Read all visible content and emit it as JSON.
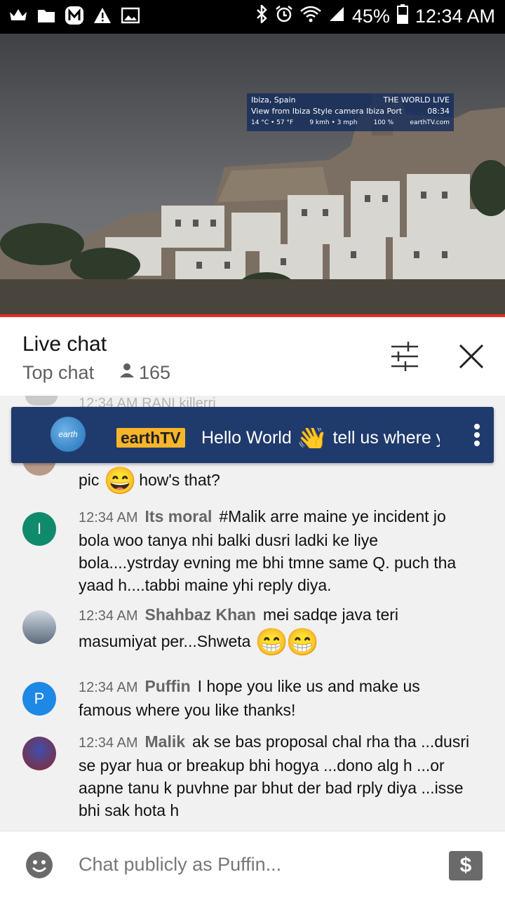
{
  "status_bar": {
    "battery": "45%",
    "time": "12:34 AM",
    "icons": [
      "crown-icon",
      "folder-icon",
      "m-app-icon",
      "warning-icon",
      "image-icon",
      "bluetooth-icon",
      "alarm-icon",
      "wifi-icon",
      "signal-icon",
      "battery-icon"
    ]
  },
  "video_overlay": {
    "location": "Ibiza, Spain",
    "brand": "THE WORLD LIVE",
    "camera": "View from Ibiza Style camera Ibiza Port",
    "clock": "08:34",
    "weather": "14 °C • 57 °F",
    "wind": "9 kmh • 3 mph",
    "humidity": "100 %",
    "site": "earthTV.com"
  },
  "header": {
    "title": "Live chat",
    "mode": "Top chat",
    "viewers": "165"
  },
  "ghost_message": {
    "time": "12:34 AM",
    "author": "RANI killerri"
  },
  "pinned": {
    "avatar_text": "earth",
    "author": "earthTV",
    "message_start": "Hello World",
    "message_end": "tell us where y"
  },
  "messages": [
    {
      "text_before": "pic",
      "text_after": "how's that?"
    },
    {
      "time": "12:34 AM",
      "author": "Its moral",
      "avatar_letter": "I",
      "avatar_color": "#0f8a6b",
      "text": "#Malik arre maine ye incident jo bola woo tanya nhi balki dusri ladki ke liye bola....ystrday evning me bhi tmne same Q. puch tha yaad h....tabbi maine yhi reply diya."
    },
    {
      "time": "12:34 AM",
      "author": "Shahbaz Khan",
      "text": "mei sadqe java teri masumiyat per...Shweta"
    },
    {
      "time": "12:34 AM",
      "author": "Puffin",
      "avatar_letter": "P",
      "avatar_color": "#1e88e5",
      "text": "I hope you like us and make us famous where you like thanks!"
    },
    {
      "time": "12:34 AM",
      "author": "Malik",
      "text": "ak se bas proposal chal rha tha ...dusri se pyar hua or breakup bhi hogya ...dono alg h ...or aapne tanu k puvhne par bhut der bad rply diya ...isse bhi sak hota h"
    }
  ],
  "composer": {
    "placeholder": "Chat publicly as Puffin...",
    "dollar_label": "$"
  }
}
